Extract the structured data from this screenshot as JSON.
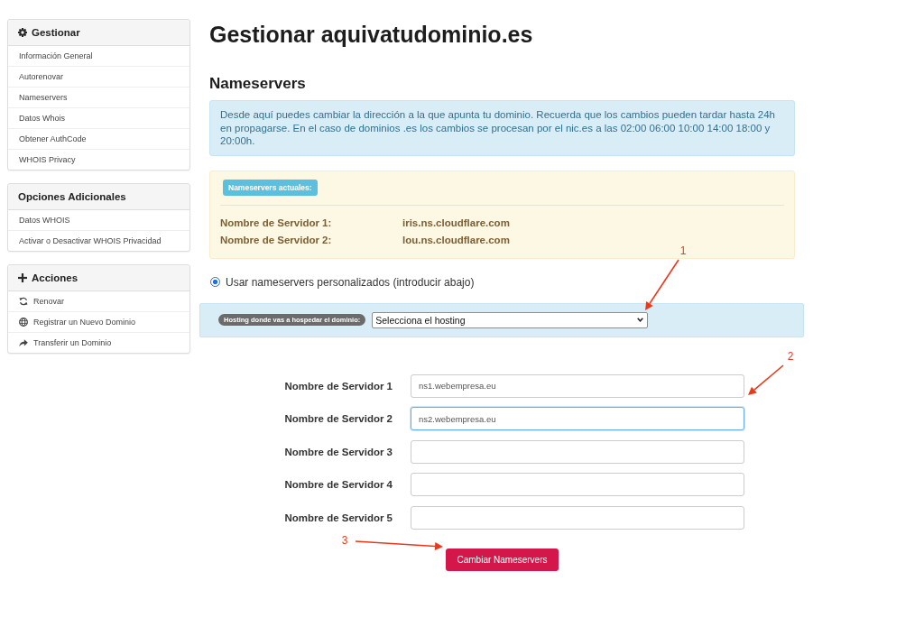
{
  "page_title": "Gestionar aquivatudominio.es",
  "sidebar": [
    {
      "title": "Gestionar",
      "items": [
        {
          "label": "Información General"
        },
        {
          "label": "Autorenovar"
        },
        {
          "label": "Nameservers"
        },
        {
          "label": "Datos Whois"
        },
        {
          "label": "Obtener AuthCode"
        },
        {
          "label": "WHOIS Privacy"
        }
      ]
    },
    {
      "title": "Opciones Adicionales",
      "items": [
        {
          "label": "Datos WHOIS"
        },
        {
          "label": "Activar o Desactivar WHOIS Privacidad"
        }
      ]
    },
    {
      "title": "Acciones",
      "items": [
        {
          "label": "Renovar"
        },
        {
          "label": "Registrar un Nuevo Dominio"
        },
        {
          "label": "Transferir un Dominio"
        }
      ]
    }
  ],
  "section_title": "Nameservers",
  "info_text": "Desde aquí puedes cambiar la dirección a la que apunta tu dominio. Recuerda que los cambios pueden tardar hasta 24h en propagarse. En el caso de dominios .es los cambios se procesan por el nic.es a las 02:00 06:00 10:00 14:00 18:00 y 20:00h.",
  "current_nameservers": {
    "badge": "Nameservers actuales:",
    "rows": [
      {
        "label": "Nombre de Servidor 1:",
        "value": "iris.ns.cloudflare.com"
      },
      {
        "label": "Nombre de Servidor 2:",
        "value": "lou.ns.cloudflare.com"
      }
    ]
  },
  "custom_option": {
    "label": "Usar nameservers personalizados (introducir abajo)",
    "selected": true
  },
  "hosting": {
    "badge": "Hosting donde vas a hospedar el dominio:",
    "value": "Selecciona el hosting"
  },
  "fields": [
    {
      "label": "Nombre de Servidor 1",
      "value": "ns1.webempresa.eu",
      "focused": false
    },
    {
      "label": "Nombre de Servidor 2",
      "value": "ns2.webempresa.eu",
      "focused": true
    },
    {
      "label": "Nombre de Servidor 3",
      "focused": false
    },
    {
      "label": "Nombre de Servidor 4",
      "focused": false
    },
    {
      "label": "Nombre de Servidor 5",
      "focused": false
    }
  ],
  "submit": "Cambiar Nameservers",
  "annotations": [
    "1",
    "2",
    "3"
  ]
}
